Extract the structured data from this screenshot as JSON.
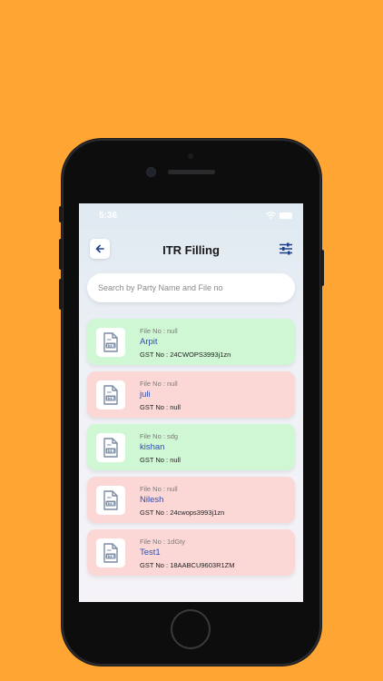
{
  "status_bar": {
    "time": "5:36"
  },
  "header": {
    "title": "ITR Filling"
  },
  "search": {
    "placeholder": "Search by Party Name and File no"
  },
  "records": [
    {
      "file_label": "File No : null",
      "name": "Arpit",
      "gst_label": "GST No : 24CWOPS3993j1zn",
      "status": "green"
    },
    {
      "file_label": "File No : null",
      "name": "juli",
      "gst_label": "GST No : null",
      "status": "red"
    },
    {
      "file_label": "File No : sdg",
      "name": "kishan",
      "gst_label": "GST No : null",
      "status": "green"
    },
    {
      "file_label": "File No : null",
      "name": "Nilesh",
      "gst_label": "GST No : 24cwops3993j1zn",
      "status": "red"
    },
    {
      "file_label": "File No : 1dGty",
      "name": "Test1",
      "gst_label": "GST No : 18AABCU9603R1ZM",
      "status": "red"
    }
  ],
  "icons": {
    "back": "arrow-left-icon",
    "filter": "sliders-icon",
    "record": "itr-document-icon"
  },
  "colors": {
    "background": "#FFA533",
    "card_green": "#CFF7D3",
    "card_red": "#FBD8D6",
    "name_text": "#2d4eb0",
    "accent": "#1f3f8f"
  }
}
